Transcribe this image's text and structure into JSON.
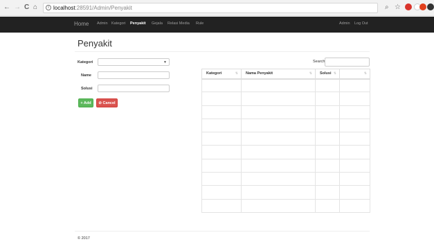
{
  "browser": {
    "back": "←",
    "forward": "→",
    "reload": "C",
    "home": "⌂",
    "url_host": "localhost",
    "url_path": ":28591/Admin/Penyakit",
    "zoom_icon": "zoom-icon",
    "star_icon": "star-icon"
  },
  "navbar": {
    "brand": "Home",
    "items": [
      "Admin",
      "Kategori",
      "Penyakit",
      "Gejala",
      "Relasi Media",
      "Rule"
    ],
    "active_index": 2,
    "user": "Admin",
    "logout": "Log Out"
  },
  "page": {
    "title": "Penyakit"
  },
  "form": {
    "kategori_label": "Kategori",
    "kategori_value": "",
    "name_label": "Name",
    "name_value": "",
    "solusi_label": "Solusi",
    "solusi_value": "",
    "add_button": "+ Add",
    "cancel_button": "⊘ Cancel"
  },
  "table": {
    "search_label": "Search:",
    "search_value": "",
    "columns": [
      "Kategori",
      "Nama Penyakit",
      "Solusi",
      ""
    ],
    "row_count": 10
  },
  "footer": {
    "text": "© 2017"
  },
  "colors": {
    "navbar": "#222222",
    "add": "#5cb85c",
    "cancel": "#d9534f"
  }
}
